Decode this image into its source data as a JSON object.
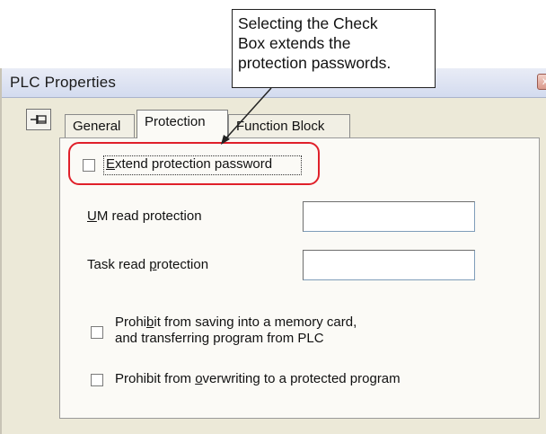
{
  "callout": {
    "lines": [
      "Selecting the Check",
      "Box extends the",
      "protection passwords."
    ]
  },
  "dialog": {
    "title": "PLC Properties",
    "close_glyph": "x"
  },
  "tabs": [
    {
      "label": "General"
    },
    {
      "label": "Protection"
    },
    {
      "label": "Function Block"
    }
  ],
  "protection": {
    "extend_password": {
      "prefix": "E",
      "rest": "xtend protection password",
      "checked": false
    },
    "um_read": {
      "prefix": "U",
      "rest": "M read protection",
      "value": ""
    },
    "task_read": {
      "pre": "Task read ",
      "underlined": "p",
      "post": "rotection",
      "value": ""
    },
    "prohibit_save": {
      "line1_pre": "Prohi",
      "line1_underlined": "b",
      "line1_post": "it from saving into a memory card,",
      "line2": "and transferring program from PLC",
      "checked": false
    },
    "prohibit_overwrite": {
      "pre": "Prohibit from ",
      "underlined": "o",
      "post": "verwriting to a protected program",
      "checked": false
    }
  },
  "colors": {
    "highlight": "#e0202a",
    "dialog_bg": "#ece9d8",
    "panel_bg": "#fbfaf6"
  }
}
